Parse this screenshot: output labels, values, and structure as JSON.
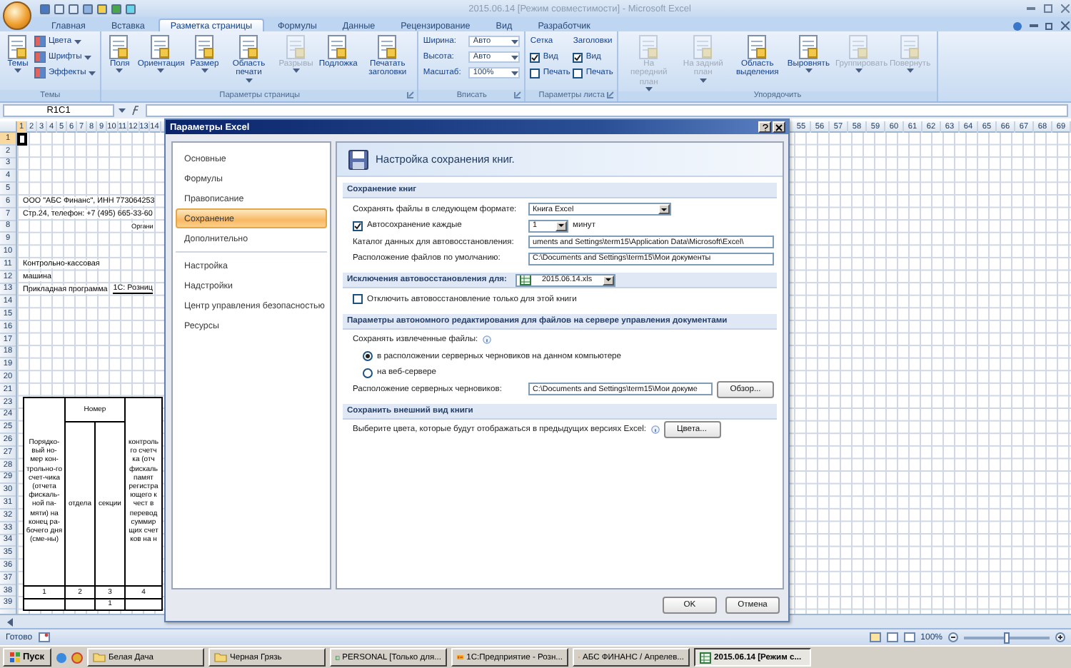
{
  "window": {
    "title": "2015.06.14  [Режим совместимости] - Microsoft Excel"
  },
  "ribbon": {
    "tabs": [
      {
        "label": "Главная",
        "selected": false
      },
      {
        "label": "Вставка",
        "selected": false
      },
      {
        "label": "Разметка страницы",
        "selected": true
      },
      {
        "label": "Формулы",
        "selected": false
      },
      {
        "label": "Данные",
        "selected": false
      },
      {
        "label": "Рецензирование",
        "selected": false
      },
      {
        "label": "Вид",
        "selected": false
      },
      {
        "label": "Разработчик",
        "selected": false
      }
    ],
    "groups": [
      {
        "title": "Темы",
        "columns": [
          {
            "items": [
              {
                "kind": "large",
                "label": "Темы",
                "dropdown": true,
                "disabled": false
              }
            ]
          },
          {
            "items": [
              {
                "kind": "small",
                "label": "Цвета",
                "dropdown": true
              },
              {
                "kind": "small",
                "label": "Шрифты",
                "dropdown": true
              },
              {
                "kind": "small",
                "label": "Эффекты",
                "dropdown": true
              }
            ]
          }
        ]
      },
      {
        "title": "Параметры страницы",
        "launcher": true,
        "columns": [
          {
            "items": [
              {
                "kind": "large",
                "label": "Поля",
                "dropdown": true,
                "disabled": false
              }
            ]
          },
          {
            "items": [
              {
                "kind": "large",
                "label": "Ориентация",
                "dropdown": true,
                "disabled": false
              }
            ]
          },
          {
            "items": [
              {
                "kind": "large",
                "label": "Размер",
                "dropdown": true,
                "disabled": false
              }
            ]
          },
          {
            "items": [
              {
                "kind": "large",
                "label": "Область печати",
                "dropdown": true,
                "disabled": false
              }
            ]
          },
          {
            "items": [
              {
                "kind": "large",
                "label": "Разрывы",
                "dropdown": true,
                "disabled": true
              }
            ]
          },
          {
            "items": [
              {
                "kind": "large",
                "label": "Подложка",
                "dropdown": false,
                "disabled": false
              }
            ]
          },
          {
            "items": [
              {
                "kind": "large",
                "label": "Печатать заголовки",
                "dropdown": false,
                "disabled": false
              }
            ]
          }
        ]
      },
      {
        "title": "Вписать",
        "launcher": true,
        "columns": [
          {
            "items": [
              {
                "kind": "field",
                "label": "Ширина:",
                "value": "Авто"
              },
              {
                "kind": "field",
                "label": "Высота:",
                "value": "Авто"
              },
              {
                "kind": "field",
                "label": "Масштаб:",
                "value": "100%"
              }
            ]
          }
        ]
      },
      {
        "title": "Параметры листа",
        "launcher": true,
        "columns": [
          {
            "items": [
              {
                "kind": "heading",
                "label": "Сетка"
              },
              {
                "kind": "check",
                "label": "Вид",
                "checked": true
              },
              {
                "kind": "check",
                "label": "Печать",
                "checked": false
              }
            ]
          },
          {
            "items": [
              {
                "kind": "heading",
                "label": "Заголовки"
              },
              {
                "kind": "check",
                "label": "Вид",
                "checked": true
              },
              {
                "kind": "check",
                "label": "Печать",
                "checked": false
              }
            ]
          }
        ]
      },
      {
        "title": "Упорядочить",
        "columns": [
          {
            "items": [
              {
                "kind": "large",
                "label": "На передний план",
                "dropdown": true,
                "disabled": true
              }
            ]
          },
          {
            "items": [
              {
                "kind": "large",
                "label": "На задний план",
                "dropdown": true,
                "disabled": true
              }
            ]
          },
          {
            "items": [
              {
                "kind": "large",
                "label": "Область выделения",
                "dropdown": false,
                "disabled": false
              }
            ]
          },
          {
            "items": [
              {
                "kind": "large",
                "label": "Выровнять",
                "dropdown": true,
                "disabled": false
              }
            ]
          },
          {
            "items": [
              {
                "kind": "large",
                "label": "Группировать",
                "dropdown": true,
                "disabled": true
              }
            ]
          },
          {
            "items": [
              {
                "kind": "large",
                "label": "Повернуть",
                "dropdown": true,
                "disabled": true
              }
            ]
          }
        ]
      }
    ]
  },
  "formula_bar": {
    "name_box": "R1C1"
  },
  "sheet": {
    "columns_left": [
      {
        "label": "1",
        "selected": true
      },
      {
        "label": "2",
        "selected": false
      },
      {
        "label": "3",
        "selected": false
      },
      {
        "label": "4",
        "selected": false
      },
      {
        "label": "5",
        "selected": false
      },
      {
        "label": "6",
        "selected": false
      },
      {
        "label": "7",
        "selected": false
      },
      {
        "label": "8",
        "selected": false
      },
      {
        "label": "9",
        "selected": false
      },
      {
        "label": "10",
        "selected": false
      },
      {
        "label": "11",
        "selected": false
      },
      {
        "label": "12",
        "selected": false
      },
      {
        "label": "13",
        "selected": false
      },
      {
        "label": "14",
        "selected": false
      }
    ],
    "columns_right": [
      {
        "label": "55",
        "selected": false
      },
      {
        "label": "56",
        "selected": false
      },
      {
        "label": "57",
        "selected": false
      },
      {
        "label": "58",
        "selected": false
      },
      {
        "label": "59",
        "selected": false
      },
      {
        "label": "60",
        "selected": false
      },
      {
        "label": "61",
        "selected": false
      },
      {
        "label": "62",
        "selected": false
      },
      {
        "label": "63",
        "selected": false
      },
      {
        "label": "64",
        "selected": false
      },
      {
        "label": "65",
        "selected": false
      },
      {
        "label": "66",
        "selected": false
      },
      {
        "label": "67",
        "selected": false
      },
      {
        "label": "68",
        "selected": false
      },
      {
        "label": "69",
        "selected": false
      }
    ],
    "rows": [
      {
        "number": "1",
        "selected": true
      },
      {
        "number": "2",
        "selected": false
      },
      {
        "number": "3",
        "selected": false
      },
      {
        "number": "4",
        "selected": false
      },
      {
        "number": "5",
        "selected": false
      },
      {
        "number": "6",
        "selected": false,
        "cells": [
          {
            "kind": "text",
            "text": "ООО \"АБС Финанс\", ИНН 773064253"
          }
        ]
      },
      {
        "number": "7",
        "selected": false,
        "cells": [
          {
            "kind": "text",
            "text": "Стр.24, телефон: +7 (495) 665-33-60"
          }
        ]
      },
      {
        "number": "8",
        "selected": false,
        "cells": [
          {
            "kind": "caption",
            "text": "Органи"
          }
        ]
      },
      {
        "number": "9",
        "selected": false
      },
      {
        "number": "10",
        "selected": false
      },
      {
        "number": "11",
        "selected": false,
        "cells": [
          {
            "kind": "text",
            "text": "Контрольно-кассовая"
          }
        ]
      },
      {
        "number": "12",
        "selected": false,
        "cells": [
          {
            "kind": "text",
            "text": "машина"
          }
        ]
      },
      {
        "number": "13",
        "selected": false,
        "cells": [
          {
            "kind": "text",
            "text": "Прикладная программа"
          },
          {
            "kind": "value",
            "text": "1С: Розниц"
          }
        ]
      },
      {
        "number": "14",
        "selected": false
      },
      {
        "number": "15",
        "selected": false
      },
      {
        "number": "16",
        "selected": false
      },
      {
        "number": "17",
        "selected": false
      },
      {
        "number": "18",
        "selected": false
      },
      {
        "number": "19",
        "selected": false
      },
      {
        "number": "20",
        "selected": false
      },
      {
        "number": "21",
        "selected": false
      }
    ],
    "table_rows": [
      {
        "number": "23",
        "selected": false
      },
      {
        "number": "24",
        "selected": false
      },
      {
        "number": "25",
        "selected": false
      },
      {
        "number": "26",
        "selected": false
      },
      {
        "number": "27",
        "selected": false
      },
      {
        "number": "28",
        "selected": false
      },
      {
        "number": "29",
        "selected": false
      },
      {
        "number": "30",
        "selected": false
      },
      {
        "number": "31",
        "selected": false
      },
      {
        "number": "32",
        "selected": false
      },
      {
        "number": "33",
        "selected": false
      },
      {
        "number": "34",
        "selected": false
      },
      {
        "number": "35",
        "selected": false
      },
      {
        "number": "36",
        "selected": false
      },
      {
        "number": "37",
        "selected": false
      },
      {
        "number": "38",
        "selected": false
      },
      {
        "number": "39",
        "selected": false
      }
    ],
    "table": {
      "column_1": "Порядко-вый но-мер кон-трольно-го счет-чика (отчета фискаль-ной па-мяти) на конец ра-бочего дня (сме-ны)",
      "group": "Номер",
      "column_2": "отдела",
      "column_3": "секции",
      "column_4": "контроль го счетч ка (отч фискаль памят регистра ющего к чест в перевод суммир щих счет ков на н",
      "index_row": [
        "1",
        "2",
        "3",
        "4"
      ],
      "data_row_column_3": "1"
    }
  },
  "dialog": {
    "title": "Параметры Excel",
    "nav": [
      {
        "items": [
          {
            "label": "Основные",
            "selected": false
          },
          {
            "label": "Формулы",
            "selected": false
          },
          {
            "label": "Правописание",
            "selected": false
          },
          {
            "label": "Сохранение",
            "selected": true
          },
          {
            "label": "Дополнительно",
            "selected": false
          }
        ]
      },
      {
        "items": [
          {
            "label": "Настройка",
            "selected": false
          },
          {
            "label": "Надстройки",
            "selected": false
          },
          {
            "label": "Центр управления безопасностью",
            "selected": false
          },
          {
            "label": "Ресурсы",
            "selected": false
          }
        ]
      }
    ],
    "heading": "Настройка сохранения книг.",
    "sections": [
      {
        "title": "Сохранение книг",
        "rows": [
          {
            "kind": "select",
            "label": "Сохранять файлы в следующем формате:",
            "value": "Книга Excel"
          },
          {
            "kind": "spin",
            "label": "Автосохранение каждые",
            "checked": true,
            "value": "1",
            "unit": "минут"
          },
          {
            "kind": "text",
            "label": "Каталог данных для автовосстановления:",
            "value": "uments and Settings\\term15\\Application Data\\Microsoft\\Excel\\"
          },
          {
            "kind": "text",
            "label": "Расположение файлов по умолчанию:",
            "value": "C:\\Documents and Settings\\term15\\Мои документы"
          }
        ]
      },
      {
        "title": "Исключения автовосстановления для:",
        "select": "2015.06.14.xls",
        "rows": [
          {
            "kind": "check",
            "label": "Отключить автовосстановление только для этой книги",
            "checked": false
          }
        ]
      },
      {
        "title": "Параметры автономного редактирования для файлов на сервере управления документами",
        "rows": [
          {
            "kind": "note",
            "label": "Сохранять извлеченные файлы:"
          },
          {
            "kind": "radio",
            "label": "в расположении серверных черновиков на данном компьютере",
            "selected": true
          },
          {
            "kind": "radio",
            "label": "на веб-сервере",
            "selected": false
          },
          {
            "kind": "browse",
            "label": "Расположение серверных черновиков:",
            "value": "C:\\Documents and Settings\\term15\\Мои докуме",
            "button": "Обзор..."
          }
        ]
      },
      {
        "title": "Сохранить внешний вид книги",
        "rows": [
          {
            "kind": "colors",
            "label": "Выберите цвета, которые будут отображаться в предыдущих версиях Excel:",
            "button": "Цвета..."
          }
        ]
      }
    ],
    "buttons": [
      "OK",
      "Отмена"
    ]
  },
  "status_bar": {
    "text": "Готово",
    "zoom": "100%",
    "zoom_slider": {
      "level": 0.5
    }
  },
  "taskbar": {
    "start": "Пуск",
    "items": [
      {
        "kind": "folder",
        "label": "Белая Дача",
        "selected": false
      },
      {
        "kind": "folder",
        "label": "Черная Грязь",
        "selected": false
      },
      {
        "kind": "excel",
        "label": "PERSONAL  [Только для...",
        "selected": false
      },
      {
        "kind": "onec",
        "label": "1С:Предприятие - Розн...",
        "selected": false
      },
      {
        "kind": "onec",
        "label": "АБС ФИНАНС / Апрелев...",
        "selected": false
      },
      {
        "kind": "excel",
        "label": "2015.06.14  [Режим с...",
        "selected": true
      }
    ]
  }
}
